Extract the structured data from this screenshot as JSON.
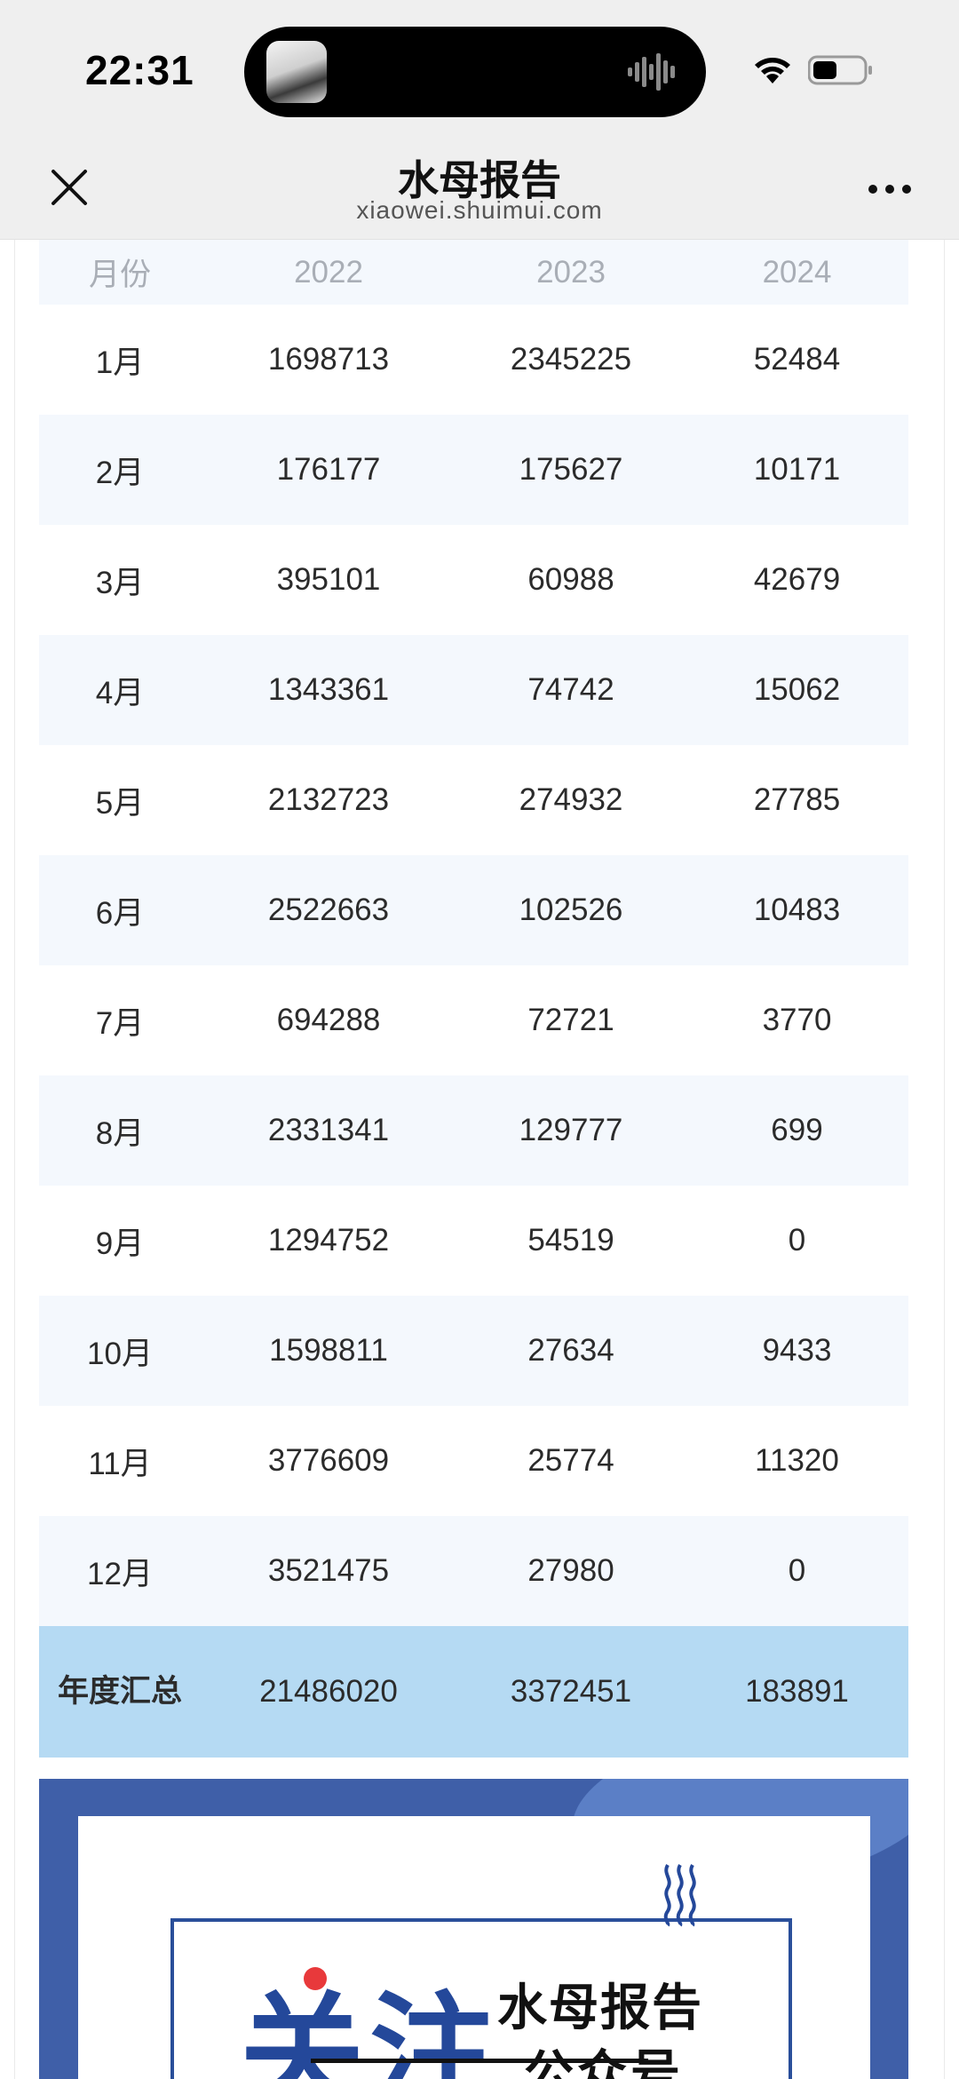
{
  "status_bar": {
    "time": "22:31"
  },
  "nav": {
    "title": "水母报告",
    "subtitle": "xiaowei.shuimui.com",
    "close_icon": "close-icon",
    "more_icon": "more-icon"
  },
  "table": {
    "headers": [
      "月份",
      "2022",
      "2023",
      "2024"
    ],
    "rows": [
      {
        "month": "1月",
        "y2022": "1698713",
        "y2023": "2345225",
        "y2024": "52484"
      },
      {
        "month": "2月",
        "y2022": "176177",
        "y2023": "175627",
        "y2024": "10171"
      },
      {
        "month": "3月",
        "y2022": "395101",
        "y2023": "60988",
        "y2024": "42679"
      },
      {
        "month": "4月",
        "y2022": "1343361",
        "y2023": "74742",
        "y2024": "15062"
      },
      {
        "month": "5月",
        "y2022": "2132723",
        "y2023": "274932",
        "y2024": "27785"
      },
      {
        "month": "6月",
        "y2022": "2522663",
        "y2023": "102526",
        "y2024": "10483"
      },
      {
        "month": "7月",
        "y2022": "694288",
        "y2023": "72721",
        "y2024": "3770"
      },
      {
        "month": "8月",
        "y2022": "2331341",
        "y2023": "129777",
        "y2024": "699"
      },
      {
        "month": "9月",
        "y2022": "1294752",
        "y2023": "54519",
        "y2024": "0"
      },
      {
        "month": "10月",
        "y2022": "1598811",
        "y2023": "27634",
        "y2024": "9433"
      },
      {
        "month": "11月",
        "y2022": "3776609",
        "y2023": "25774",
        "y2024": "11320"
      },
      {
        "month": "12月",
        "y2022": "3521475",
        "y2023": "27980",
        "y2024": "0"
      }
    ],
    "total": {
      "label": "年度汇总",
      "y2022": "21486020",
      "y2023": "3372451",
      "y2024": "183891"
    }
  },
  "banner": {
    "follow": "关注",
    "brand": "水母报告",
    "account": "公众号"
  },
  "colors": {
    "table_alt_row": "#f4f8fd",
    "total_row": "#b5daf3",
    "banner_bg": "#3f5fa8",
    "banner_accent": "#24489a"
  }
}
